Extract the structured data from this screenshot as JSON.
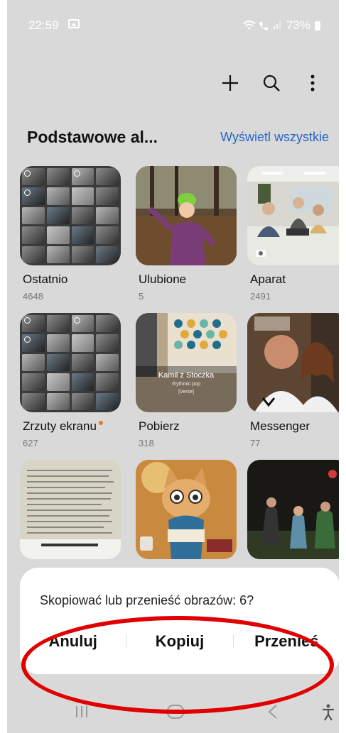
{
  "status_bar": {
    "time": "22:59",
    "battery": "73%",
    "icons": "wifi-calls-signal"
  },
  "toolbar": {
    "add_icon": "plus-icon",
    "search_icon": "search-icon",
    "more_icon": "more-vertical-icon"
  },
  "section": {
    "title": "Podstawowe al...",
    "view_all": "Wyświetl wszystkie"
  },
  "albums": [
    {
      "name": "Ostatnio",
      "count": "4648"
    },
    {
      "name": "Ulubione",
      "count": "5"
    },
    {
      "name": "Aparat",
      "count": "2491"
    },
    {
      "name": "Zrzuty ekranu",
      "count": "627"
    },
    {
      "name": "Pobierz",
      "count": "318"
    },
    {
      "name": "Messenger",
      "count": "77"
    }
  ],
  "pobierz_thumb": {
    "title": "Kamil z Stoczka",
    "subtitle": "rhythmic pop",
    "verse": "[Verse]"
  },
  "dialog": {
    "message": "Skopiować lub przenieść obrazów: 6?",
    "cancel": "Anuluj",
    "copy": "Kopiuj",
    "move": "Przenieś"
  },
  "navbar": {
    "recent": "recent-apps-icon",
    "home": "home-icon",
    "back": "back-icon",
    "accessibility": "accessibility-icon"
  },
  "colors": {
    "accent_link": "#2666c7",
    "annotation": "#e00000",
    "notification_dot": "#e87722"
  }
}
